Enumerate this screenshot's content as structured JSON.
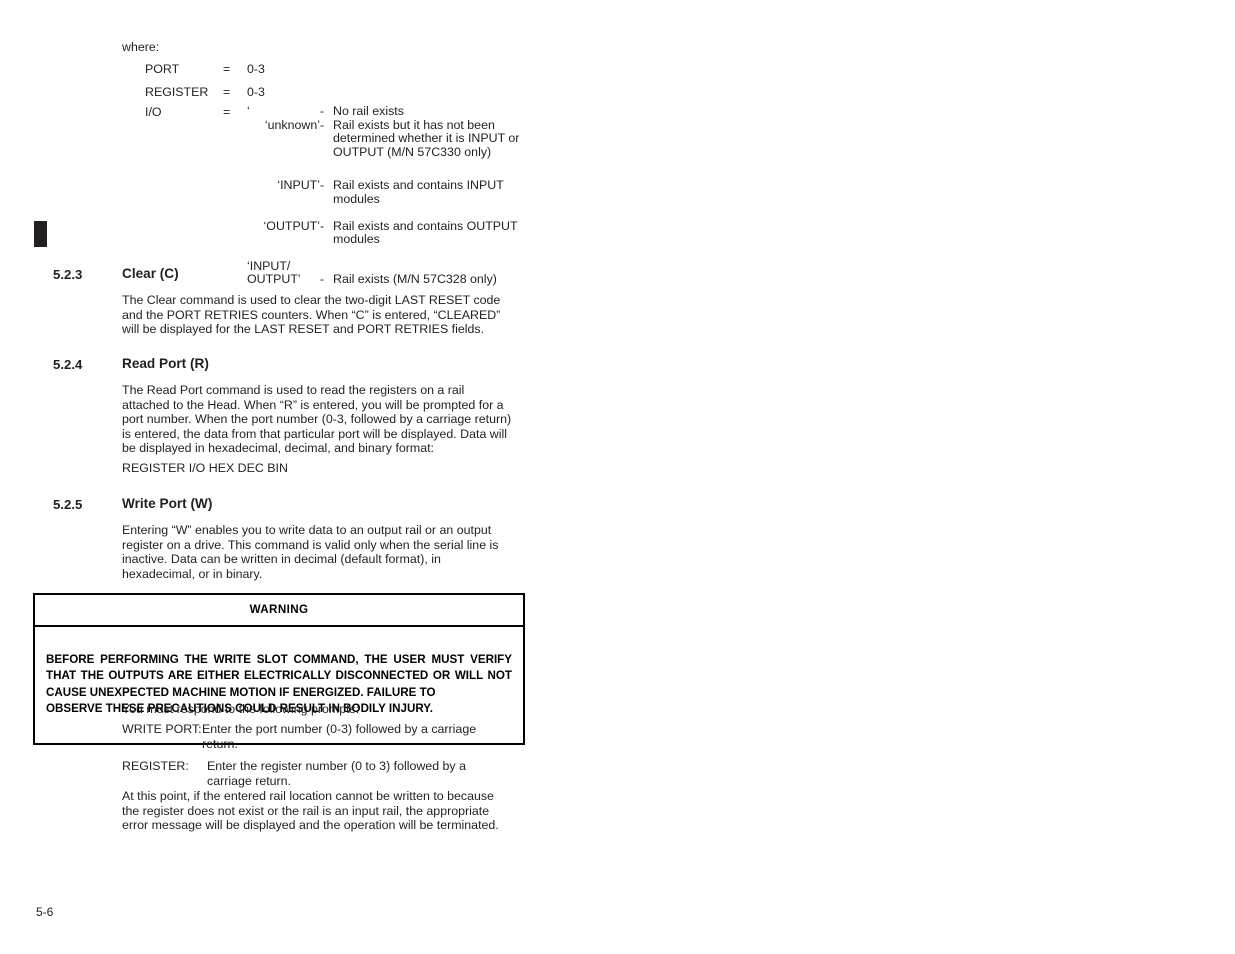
{
  "where": {
    "label": "where:",
    "rows": [
      {
        "term": "PORT",
        "eq": "=",
        "value": "0-3"
      },
      {
        "term": "REGISTER",
        "eq": "=",
        "value": "0-3"
      }
    ],
    "io": {
      "term": "I/O",
      "eq": "=",
      "entries": [
        {
          "value": "‘",
          "dash": "-",
          "desc": "No rail exists"
        },
        {
          "value": "‘unknown’",
          "dash": "-",
          "desc": "Rail exists but it has not been\ndetermined whether it is INPUT or\nOUTPUT (M/N 57C330 only)"
        },
        {
          "value": "‘INPUT’",
          "dash": "-",
          "desc": "Rail exists and contains INPUT\nmodules"
        },
        {
          "value": "‘OUTPUT’",
          "dash": "-",
          "desc": "Rail exists and contains OUTPUT\nmodules"
        },
        {
          "value": "‘INPUT/\nOUTPUT’",
          "dash": "-",
          "desc": "Rail exists (M/N 57C328 only)"
        }
      ]
    }
  },
  "sections": {
    "clear": {
      "number": "5.2.3",
      "title": "Clear (C)",
      "paragraph": "The Clear command is used to clear the two-digit LAST RESET code and the PORT RETRIES counters. When “C” is entered, “CLEARED” will be displayed for the LAST RESET and PORT RETRIES fields."
    },
    "read_port": {
      "number": "5.2.4",
      "title": "Read Port (R)",
      "paragraph": "The Read Port command is used to read the registers on a rail attached to the Head. When “R” is entered, you will be prompted for a port number. When the port number (0-3, followed by a carriage return) is entered, the data from that particular port will be displayed. Data will be displayed in hexadecimal, decimal, and binary format:",
      "format_line": "REGISTER   I/O   HEX   DEC   BIN"
    },
    "write_port": {
      "number": "5.2.5",
      "title": "Write Port (W)",
      "paragraph": "Entering “W” enables you to write data to an output rail or an output register on a drive.  This command is valid only when the serial line is inactive. Data can be written in decimal (default format), in hexadecimal, or in binary."
    }
  },
  "warning": {
    "title": "WARNING",
    "body": "BEFORE PERFORMING THE WRITE SLOT COMMAND, THE USER MUST VERIFY THAT THE OUTPUTS ARE EITHER ELECTRICALLY DISCONNECTED OR WILL NOT CAUSE UNEXPECTED MACHINE MOTION IF ENERGIZED. FAILURE TO",
    "body_last_line": "OBSERVE THESE PRECAUTIONS COULD RESULT IN BODILY INJURY."
  },
  "prompts": {
    "intro": "You must respond to the following prompts:",
    "items": [
      {
        "label": "WRITE PORT:",
        "description": "Enter the port number (0-3) followed by a carriage\nreturn."
      },
      {
        "label": "REGISTER:",
        "description": "Enter the register number (0 to 3) followed by a\ncarriage return."
      }
    ],
    "closing": "At this point, if the entered rail location cannot be written to because the register does not exist or the rail is an input rail, the appropriate error message will be displayed and the operation will be terminated."
  },
  "footer": {
    "page_number": "5-6"
  },
  "colors": {
    "text": "#231f20",
    "rule": "#000000",
    "change_bar": "#231f20"
  }
}
